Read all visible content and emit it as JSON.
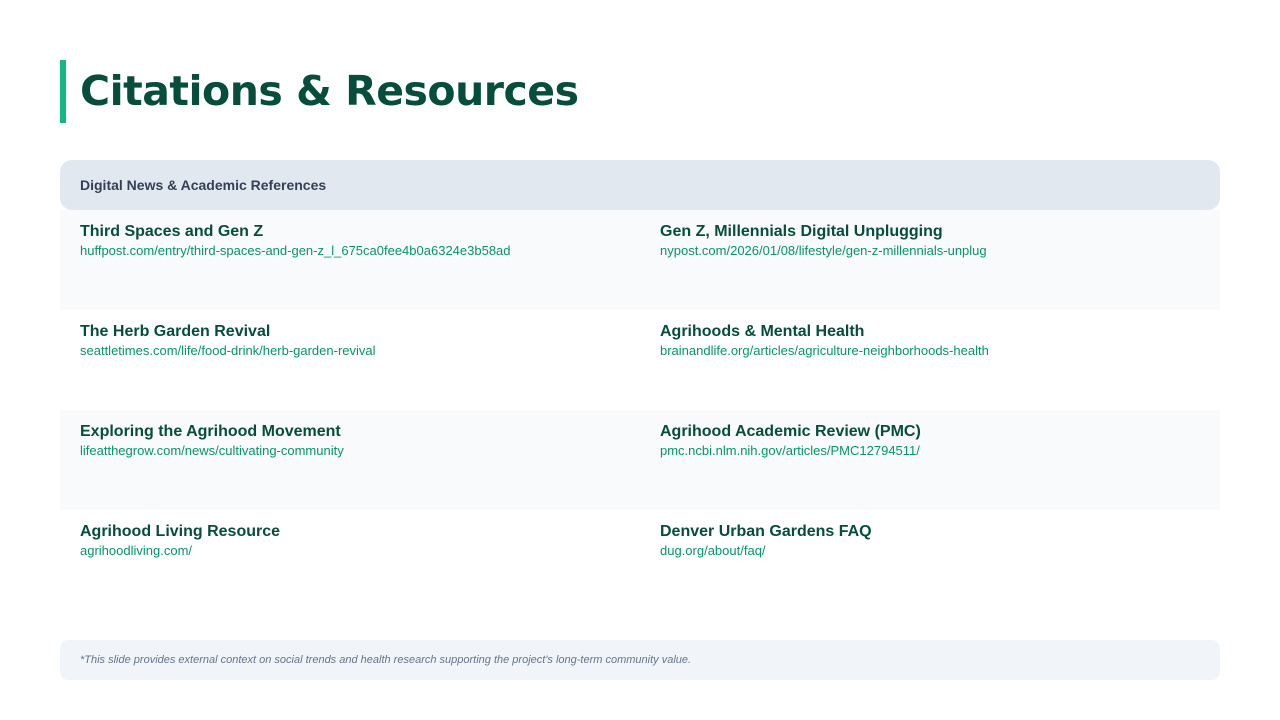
{
  "slide": {
    "title": "Citations & Resources",
    "accent_color": "#10b981",
    "title_color": "#064e3b"
  },
  "table": {
    "header": "Digital News & Academic References",
    "rows": [
      [
        {
          "title": "Third Spaces and Gen Z",
          "url": "huffpost.com/entry/third-spaces-and-gen-z_l_675ca0fee4b0a6324e3b58ad"
        },
        {
          "title": "Gen Z, Millennials Digital Unplugging",
          "url": "nypost.com/2026/01/08/lifestyle/gen-z-millennials-unplug"
        }
      ],
      [
        {
          "title": "The Herb Garden Revival",
          "url": "seattletimes.com/life/food-drink/herb-garden-revival"
        },
        {
          "title": "Agrihoods & Mental Health",
          "url": "brainandlife.org/articles/agriculture-neighborhoods-health"
        }
      ],
      [
        {
          "title": "Exploring the Agrihood Movement",
          "url": "lifeatthegrow.com/news/cultivating-community"
        },
        {
          "title": "Agrihood Academic Review (PMC)",
          "url": "pmc.ncbi.nlm.nih.gov/articles/PMC12794511/"
        }
      ],
      [
        {
          "title": "Agrihood Living Resource",
          "url": "agrihoodliving.com/"
        },
        {
          "title": "Denver Urban Gardens FAQ",
          "url": "dug.org/about/faq/"
        }
      ]
    ]
  },
  "footnote": "*This slide provides external context on social trends and health research supporting the project's long-term community value."
}
